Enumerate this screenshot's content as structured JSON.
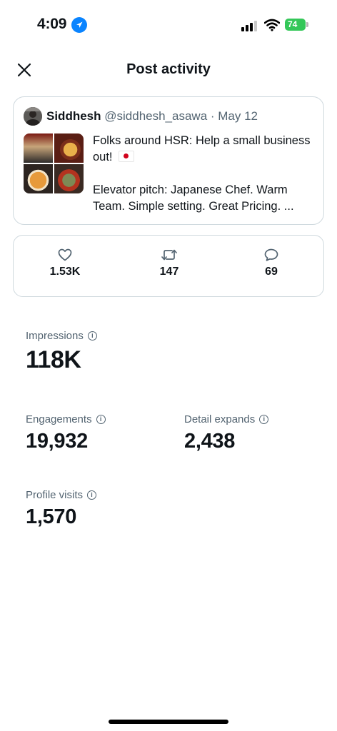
{
  "status_bar": {
    "time": "4:09",
    "battery": "74",
    "colors": {
      "battery": "#34c759",
      "location": "#0a84ff"
    }
  },
  "header": {
    "title": "Post activity",
    "close_icon": "close-icon"
  },
  "post": {
    "author_name": "Siddhesh",
    "author_handle": "@siddhesh_asawa · May 12",
    "text_line1": "Folks around HSR: Help a small business out!",
    "flag_icon": "japan-flag-icon",
    "text_line2": "Elevator pitch: Japanese Chef. Warm Team. Simple setting. Great Pricing. ..."
  },
  "engagement": {
    "likes": {
      "icon": "heart-icon",
      "value": "1.53K"
    },
    "reposts": {
      "icon": "repost-icon",
      "value": "147"
    },
    "replies": {
      "icon": "reply-icon",
      "value": "69"
    }
  },
  "metrics": {
    "impressions": {
      "label": "Impressions",
      "value": "118K"
    },
    "engagements": {
      "label": "Engagements",
      "value": "19,932"
    },
    "detail_expands": {
      "label": "Detail expands",
      "value": "2,438"
    },
    "profile_visits": {
      "label": "Profile visits",
      "value": "1,570"
    }
  }
}
